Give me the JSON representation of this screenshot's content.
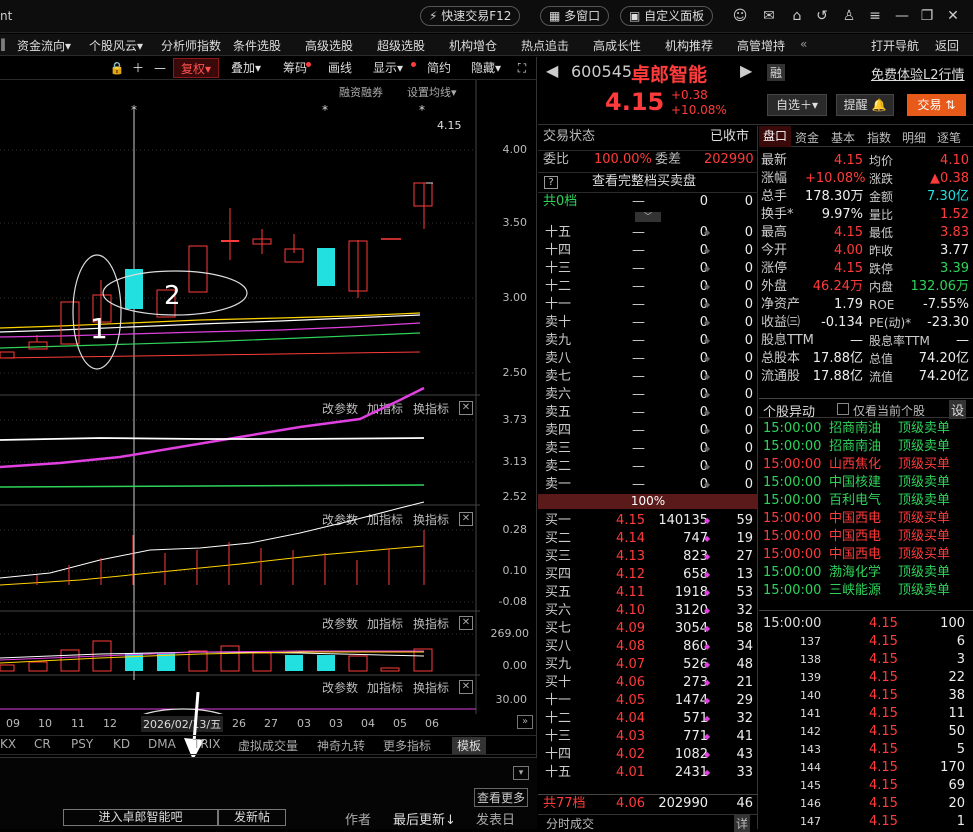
{
  "topbar": {
    "left_text": "nt",
    "quick_trade": "快速交易F12",
    "multi_window": "多窗口",
    "custom_panel": "自定义面板"
  },
  "menu": [
    "资金流向▾",
    "个股风云▾",
    "分析师指数",
    "条件选股",
    "高级选股",
    "超级选股",
    "机构增仓",
    "热点追击",
    "高成长性",
    "机构推荐",
    "高管增持"
  ],
  "menu_right": [
    "打开导航",
    "返回"
  ],
  "chart_toolbar": [
    "复权▾",
    "叠加▾",
    "筹码",
    "画线",
    "显示▾",
    "简约",
    "隐藏▾"
  ],
  "chart": {
    "top_labels": [
      "融资融券",
      "设置均线▾"
    ],
    "price_axis": [
      "4.00",
      "3.50",
      "3.00",
      "2.50"
    ],
    "last_price_tag": "4.15",
    "annotations": [
      "1",
      "2"
    ],
    "indicator_buttons": [
      "改参数",
      "加指标",
      "换指标"
    ],
    "ind1_axis": [
      "3.73",
      "3.13",
      "2.52"
    ],
    "ind2_axis": [
      "0.28",
      "0.10",
      "-0.08"
    ],
    "ind3_axis": [
      "269.00",
      "0.00"
    ],
    "ind4_axis": [
      "30.00"
    ],
    "x_labels": [
      "09",
      "10",
      "11",
      "12",
      "26",
      "27",
      "03",
      "03",
      "04",
      "05",
      "06"
    ],
    "cursor_date": "2026/02/13/五",
    "bottom_tabs": [
      "KX",
      "CR",
      "PSY",
      "KD",
      "DMA",
      "TRIX",
      "虚拟成交量",
      "神奇九转",
      "更多指标",
      "模板"
    ]
  },
  "bottom_bar": {
    "forum_button": "进入卓郎智能吧",
    "post_button": "发新帖",
    "author": "作者",
    "latest_update": "最后更新↓",
    "post_date": "发表日",
    "view_more": "查看更多"
  },
  "stock": {
    "code": "600545",
    "name": "卓郎智能",
    "margin_tag": "融",
    "l2_link": "免费体验L2行情",
    "price": "4.15",
    "change": "+0.38",
    "change_pct": "+10.08%",
    "watch_button": "自选＋▾",
    "remind_button": "提醒",
    "trade_button": "交易"
  },
  "orderbook": {
    "status_label": "交易状态",
    "status_value": "已收市",
    "ratio_label": "委比",
    "ratio_value": "100.00%",
    "diff_label": "委差",
    "diff_value": "202990",
    "full_depth": "查看完整档买卖盘",
    "sell_total_label": "共0档",
    "sell_total": {
      "p": "—",
      "v": "0",
      "c": "0"
    },
    "sells": [
      {
        "l": "十五",
        "p": "—",
        "v": "0",
        "c": "0"
      },
      {
        "l": "十四",
        "p": "—",
        "v": "0",
        "c": "0"
      },
      {
        "l": "十三",
        "p": "—",
        "v": "0",
        "c": "0"
      },
      {
        "l": "十二",
        "p": "—",
        "v": "0",
        "c": "0"
      },
      {
        "l": "十一",
        "p": "—",
        "v": "0",
        "c": "0"
      },
      {
        "l": "卖十",
        "p": "—",
        "v": "0",
        "c": "0"
      },
      {
        "l": "卖九",
        "p": "—",
        "v": "0",
        "c": "0"
      },
      {
        "l": "卖八",
        "p": "—",
        "v": "0",
        "c": "0"
      },
      {
        "l": "卖七",
        "p": "—",
        "v": "0",
        "c": "0"
      },
      {
        "l": "卖六",
        "p": "—",
        "v": "0",
        "c": "0"
      },
      {
        "l": "卖五",
        "p": "—",
        "v": "0",
        "c": "0"
      },
      {
        "l": "卖四",
        "p": "—",
        "v": "0",
        "c": "0"
      },
      {
        "l": "卖三",
        "p": "—",
        "v": "0",
        "c": "0"
      },
      {
        "l": "卖二",
        "p": "—",
        "v": "0",
        "c": "0"
      },
      {
        "l": "卖一",
        "p": "—",
        "v": "0",
        "c": "0"
      }
    ],
    "bar_pct": "100%",
    "buys": [
      {
        "l": "买一",
        "p": "4.15",
        "v": "140135",
        "c": "59"
      },
      {
        "l": "买二",
        "p": "4.14",
        "v": "747",
        "c": "19"
      },
      {
        "l": "买三",
        "p": "4.13",
        "v": "823",
        "c": "27"
      },
      {
        "l": "买四",
        "p": "4.12",
        "v": "658",
        "c": "13"
      },
      {
        "l": "买五",
        "p": "4.11",
        "v": "1918",
        "c": "53"
      },
      {
        "l": "买六",
        "p": "4.10",
        "v": "3120",
        "c": "32"
      },
      {
        "l": "买七",
        "p": "4.09",
        "v": "3054",
        "c": "58"
      },
      {
        "l": "买八",
        "p": "4.08",
        "v": "860",
        "c": "34"
      },
      {
        "l": "买九",
        "p": "4.07",
        "v": "526",
        "c": "48"
      },
      {
        "l": "买十",
        "p": "4.06",
        "v": "273",
        "c": "21"
      },
      {
        "l": "十一",
        "p": "4.05",
        "v": "1474",
        "c": "29"
      },
      {
        "l": "十二",
        "p": "4.04",
        "v": "571",
        "c": "32"
      },
      {
        "l": "十三",
        "p": "4.03",
        "v": "771",
        "c": "41"
      },
      {
        "l": "十四",
        "p": "4.02",
        "v": "1082",
        "c": "43"
      },
      {
        "l": "十五",
        "p": "4.01",
        "v": "2431",
        "c": "33"
      }
    ],
    "buy_total_label": "共77档",
    "buy_total": {
      "p": "4.06",
      "v": "202990",
      "c": "46"
    },
    "tick_footer": "分时成交",
    "tick_footer_btn": "详"
  },
  "quote_tabs": [
    "盘口",
    "资金",
    "基本",
    "指数",
    "明细",
    "逐笔"
  ],
  "quote": [
    {
      "l1": "最新",
      "v1": "4.15",
      "c1": "red",
      "l2": "均价",
      "v2": "4.10",
      "c2": "red"
    },
    {
      "l1": "涨幅",
      "v1": "+10.08%",
      "c1": "red",
      "l2": "涨跌",
      "v2": "▲0.38",
      "c2": "red"
    },
    {
      "l1": "总手",
      "v1": "178.30万",
      "c1": "white",
      "l2": "金额",
      "v2": "7.30亿",
      "c2": "cyan"
    },
    {
      "l1": "换手*",
      "v1": "9.97%",
      "c1": "white",
      "l2": "量比",
      "v2": "1.52",
      "c2": "red"
    },
    {
      "l1": "最高",
      "v1": "4.15",
      "c1": "red",
      "l2": "最低",
      "v2": "3.83",
      "c2": "red"
    },
    {
      "l1": "今开",
      "v1": "4.00",
      "c1": "red",
      "l2": "昨收",
      "v2": "3.77",
      "c2": "white"
    },
    {
      "l1": "涨停",
      "v1": "4.15",
      "c1": "red",
      "l2": "跌停",
      "v2": "3.39",
      "c2": "green"
    },
    {
      "l1": "外盘",
      "v1": "46.24万",
      "c1": "red",
      "l2": "内盘",
      "v2": "132.06万",
      "c2": "green"
    },
    {
      "l1": "净资产",
      "v1": "1.79",
      "c1": "white",
      "l2": "ROE",
      "v2": "-7.55%",
      "c2": "white"
    },
    {
      "l1": "收益㈢",
      "v1": "-0.134",
      "c1": "white",
      "l2": "PE(动)*",
      "v2": "-23.30",
      "c2": "white"
    },
    {
      "l1": "股息TTM",
      "v1": "—",
      "c1": "white",
      "l2": "股息率TTM",
      "v2": "—",
      "c2": "white"
    },
    {
      "l1": "总股本",
      "v1": "17.88亿",
      "c1": "white",
      "l2": "总值",
      "v2": "74.20亿",
      "c2": "white"
    },
    {
      "l1": "流通股",
      "v1": "17.88亿",
      "c1": "white",
      "l2": "流值",
      "v2": "74.20亿",
      "c2": "white"
    }
  ],
  "anomaly": {
    "title": "个股异动",
    "checkbox_label": "仅看当前个股",
    "settings": "设",
    "rows": [
      {
        "t": "15:00:00",
        "n": "招商南油",
        "a": "顶级卖单",
        "tc": "green",
        "nc": "green",
        "ac": "green"
      },
      {
        "t": "15:00:00",
        "n": "招商南油",
        "a": "顶级卖单",
        "tc": "green",
        "nc": "green",
        "ac": "green"
      },
      {
        "t": "15:00:00",
        "n": "山西焦化",
        "a": "顶级买单",
        "tc": "red",
        "nc": "red",
        "ac": "red"
      },
      {
        "t": "15:00:00",
        "n": "中国核建",
        "a": "顶级卖单",
        "tc": "green",
        "nc": "green",
        "ac": "green"
      },
      {
        "t": "15:00:00",
        "n": "百利电气",
        "a": "顶级卖单",
        "tc": "green",
        "nc": "green",
        "ac": "green"
      },
      {
        "t": "15:00:00",
        "n": "中国西电",
        "a": "顶级买单",
        "tc": "red",
        "nc": "red",
        "ac": "red"
      },
      {
        "t": "15:00:00",
        "n": "中国西电",
        "a": "顶级买单",
        "tc": "red",
        "nc": "red",
        "ac": "red"
      },
      {
        "t": "15:00:00",
        "n": "中国西电",
        "a": "顶级买单",
        "tc": "red",
        "nc": "red",
        "ac": "red"
      },
      {
        "t": "15:00:00",
        "n": "渤海化学",
        "a": "顶级卖单",
        "tc": "green",
        "nc": "green",
        "ac": "green"
      },
      {
        "t": "15:00:00",
        "n": "三峡能源",
        "a": "顶级卖单",
        "tc": "green",
        "nc": "green",
        "ac": "green"
      }
    ]
  },
  "ticks": [
    {
      "t": "15:00:00",
      "p": "4.15",
      "v": "100"
    },
    {
      "t": "137",
      "p": "4.15",
      "v": "6"
    },
    {
      "t": "138",
      "p": "4.15",
      "v": "3"
    },
    {
      "t": "139",
      "p": "4.15",
      "v": "22"
    },
    {
      "t": "140",
      "p": "4.15",
      "v": "38"
    },
    {
      "t": "141",
      "p": "4.15",
      "v": "11"
    },
    {
      "t": "142",
      "p": "4.15",
      "v": "50"
    },
    {
      "t": "143",
      "p": "4.15",
      "v": "5"
    },
    {
      "t": "144",
      "p": "4.15",
      "v": "170"
    },
    {
      "t": "145",
      "p": "4.15",
      "v": "69"
    },
    {
      "t": "146",
      "p": "4.15",
      "v": "20"
    },
    {
      "t": "147",
      "p": "4.15",
      "v": "1"
    }
  ],
  "colors": {
    "up": "#ff3b3b",
    "down": "#2fd35a",
    "bull_fill": "#22e0e0",
    "accent": "#e85a1a",
    "ma1": "#ffffff",
    "ma2": "#ffd400",
    "ma3": "#e040e0",
    "ma4": "#2fd35a"
  }
}
